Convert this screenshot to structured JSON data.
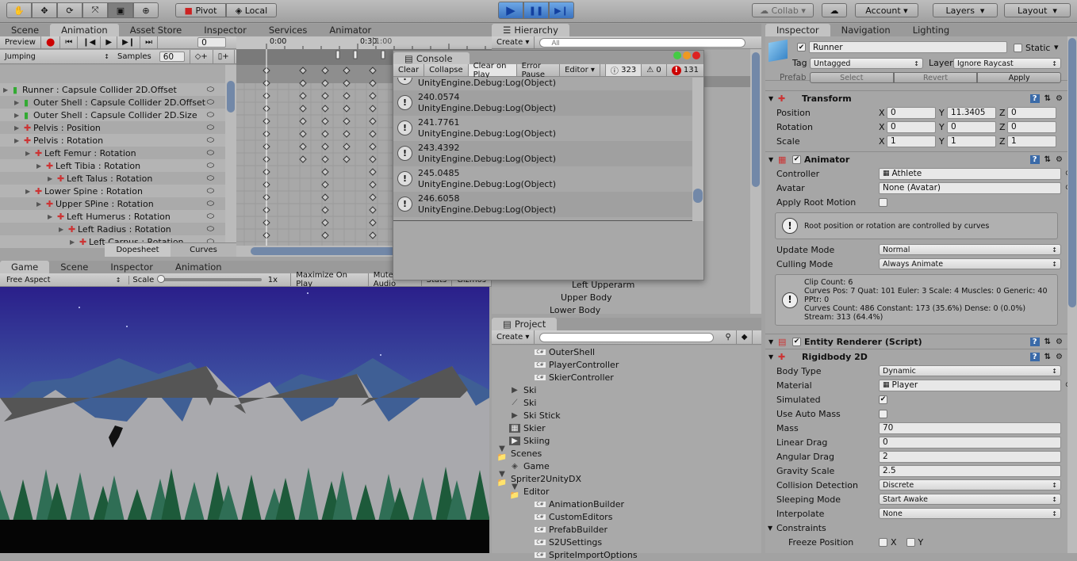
{
  "toolbar": {
    "tools": [
      "hand-tool",
      "move-tool",
      "rotate-tool",
      "scale-tool",
      "rect-tool",
      "transform-tool"
    ],
    "pivot": "Pivot",
    "local": "Local",
    "collab": "Collab",
    "account": "Account",
    "layers": "Layers",
    "layout": "Layout"
  },
  "animation": {
    "tabs": [
      "Scene",
      "Animation",
      "Asset Store",
      "Inspector",
      "Services",
      "Animator"
    ],
    "active_tab": "Animation",
    "preview": "Preview",
    "frame": "0",
    "clip": "Jumping",
    "samples_label": "Samples",
    "samples": "60",
    "time_labels": [
      "0:00",
      "0:30",
      "1:00"
    ],
    "tracks": [
      {
        "name": "Runner : Capsule Collider 2D.Offset",
        "indent": 0,
        "icon": "collider"
      },
      {
        "name": "Outer Shell : Capsule Collider 2D.Offset",
        "indent": 1,
        "icon": "collider"
      },
      {
        "name": "Outer Shell : Capsule Collider 2D.Size",
        "indent": 1,
        "icon": "collider"
      },
      {
        "name": "Pelvis : Position",
        "indent": 1,
        "icon": "transform"
      },
      {
        "name": "Pelvis : Rotation",
        "indent": 1,
        "icon": "transform"
      },
      {
        "name": "Left Femur : Rotation",
        "indent": 2,
        "icon": "transform"
      },
      {
        "name": "Left Tibia : Rotation",
        "indent": 3,
        "icon": "transform"
      },
      {
        "name": "Left Talus : Rotation",
        "indent": 4,
        "icon": "transform"
      },
      {
        "name": "Lower Spine : Rotation",
        "indent": 2,
        "icon": "transform"
      },
      {
        "name": "Upper SPine : Rotation",
        "indent": 3,
        "icon": "transform"
      },
      {
        "name": "Left Humerus : Rotation",
        "indent": 4,
        "icon": "transform"
      },
      {
        "name": "Left Radius : Rotation",
        "indent": 5,
        "icon": "transform"
      },
      {
        "name": "Left Carpus : Rotation",
        "indent": 6,
        "icon": "transform"
      }
    ],
    "dopesheet": "Dopesheet",
    "curves": "Curves"
  },
  "console": {
    "title": "Console",
    "buttons": [
      "Clear",
      "Collapse",
      "Clear on Play",
      "Error Pause",
      "Editor"
    ],
    "log_count": "323",
    "warn_count": "0",
    "error_count": "131",
    "entries": [
      {
        "value": "",
        "source": "UnityEngine.Debug:Log(Object)"
      },
      {
        "value": "240.0574",
        "source": "UnityEngine.Debug:Log(Object)"
      },
      {
        "value": "241.7761",
        "source": "UnityEngine.Debug:Log(Object)"
      },
      {
        "value": "243.4392",
        "source": "UnityEngine.Debug:Log(Object)"
      },
      {
        "value": "245.0485",
        "source": "UnityEngine.Debug:Log(Object)"
      },
      {
        "value": "246.6058",
        "source": "UnityEngine.Debug:Log(Object)"
      }
    ]
  },
  "game": {
    "tabs": [
      "Game",
      "Scene",
      "Inspector",
      "Animation"
    ],
    "aspect": "Free Aspect",
    "scale_label": "Scale",
    "scale_value": "1x",
    "buttons": [
      "Maximize On Play",
      "Mute Audio",
      "Stats",
      "Gizmos"
    ],
    "sky_top": "#2a1f8a",
    "sky_bottom": "#4a6fb0"
  },
  "hierarchy": {
    "title": "Hierarchy",
    "create": "Create",
    "search_placeholder": "All",
    "items": [
      "Left Upperarm",
      "Upper Body",
      "Lower Body"
    ]
  },
  "project": {
    "title": "Project",
    "create": "Create",
    "items": [
      {
        "name": "OuterShell",
        "indent": 3,
        "icon": "script"
      },
      {
        "name": "PlayerController",
        "indent": 3,
        "icon": "script"
      },
      {
        "name": "SkierController",
        "indent": 3,
        "icon": "script"
      },
      {
        "name": "Ski",
        "indent": 1,
        "icon": "arrow"
      },
      {
        "name": "Ski",
        "indent": 1,
        "icon": "bone"
      },
      {
        "name": "Ski Stick",
        "indent": 1,
        "icon": "arrow"
      },
      {
        "name": "Skier",
        "indent": 1,
        "icon": "prefab"
      },
      {
        "name": "Skiing",
        "indent": 1,
        "icon": "anim"
      },
      {
        "name": "Scenes",
        "indent": 0,
        "icon": "folder"
      },
      {
        "name": "Game",
        "indent": 1,
        "icon": "unity"
      },
      {
        "name": "Spriter2UnityDX",
        "indent": 0,
        "icon": "folder"
      },
      {
        "name": "Editor",
        "indent": 1,
        "icon": "folder"
      },
      {
        "name": "AnimationBuilder",
        "indent": 3,
        "icon": "script"
      },
      {
        "name": "CustomEditors",
        "indent": 3,
        "icon": "script"
      },
      {
        "name": "PrefabBuilder",
        "indent": 3,
        "icon": "script"
      },
      {
        "name": "S2USettings",
        "indent": 3,
        "icon": "script"
      },
      {
        "name": "SpriteImportOptions",
        "indent": 3,
        "icon": "script"
      }
    ]
  },
  "inspector": {
    "tabs": [
      "Inspector",
      "Navigation",
      "Lighting"
    ],
    "object_name": "Runner",
    "static_label": "Static",
    "tag_label": "Tag",
    "tag": "Untagged",
    "layer_label": "Layer",
    "layer": "Ignore Raycast",
    "prefab_label": "Prefab",
    "prefab_buttons": [
      "Select",
      "Revert",
      "Apply"
    ],
    "transform": {
      "title": "Transform",
      "rows": [
        {
          "label": "Position",
          "x": "0",
          "y": "11.3405",
          "z": "0"
        },
        {
          "label": "Rotation",
          "x": "0",
          "y": "0",
          "z": "0"
        },
        {
          "label": "Scale",
          "x": "1",
          "y": "1",
          "z": "1"
        }
      ]
    },
    "animator": {
      "title": "Animator",
      "controller_label": "Controller",
      "controller": "Athlete",
      "avatar_label": "Avatar",
      "avatar": "None (Avatar)",
      "root_motion_label": "Apply Root Motion",
      "root_info": "Root position or rotation are controlled by curves",
      "update_label": "Update Mode",
      "update": "Normal",
      "culling_label": "Culling Mode",
      "culling": "Always Animate",
      "stats": "Clip Count: 6\nCurves Pos: 7 Quat: 101 Euler: 3 Scale: 4 Muscles: 0 Generic: 40 PPtr: 0\nCurves Count: 486 Constant: 173 (35.6%) Dense: 0 (0.0%) Stream: 313 (64.4%)"
    },
    "entity_renderer": {
      "title": "Entity Renderer (Script)"
    },
    "rigidbody": {
      "title": "Rigidbody 2D",
      "rows": [
        {
          "label": "Body Type",
          "type": "drop",
          "value": "Dynamic"
        },
        {
          "label": "Material",
          "type": "obj",
          "value": "Player"
        },
        {
          "label": "Simulated",
          "type": "check",
          "value": true
        },
        {
          "label": "Use Auto Mass",
          "type": "check",
          "value": false
        },
        {
          "label": "Mass",
          "type": "field",
          "value": "70"
        },
        {
          "label": "Linear Drag",
          "type": "field",
          "value": "0"
        },
        {
          "label": "Angular Drag",
          "type": "field",
          "value": "2"
        },
        {
          "label": "Gravity Scale",
          "type": "field",
          "value": "2.5"
        },
        {
          "label": "Collision Detection",
          "type": "drop",
          "value": "Discrete"
        },
        {
          "label": "Sleeping Mode",
          "type": "drop",
          "value": "Start Awake"
        },
        {
          "label": "Interpolate",
          "type": "drop",
          "value": "None"
        }
      ],
      "constraints": "Constraints",
      "freeze_label": "Freeze Position",
      "freeze_x": "X",
      "freeze_y": "Y"
    }
  }
}
